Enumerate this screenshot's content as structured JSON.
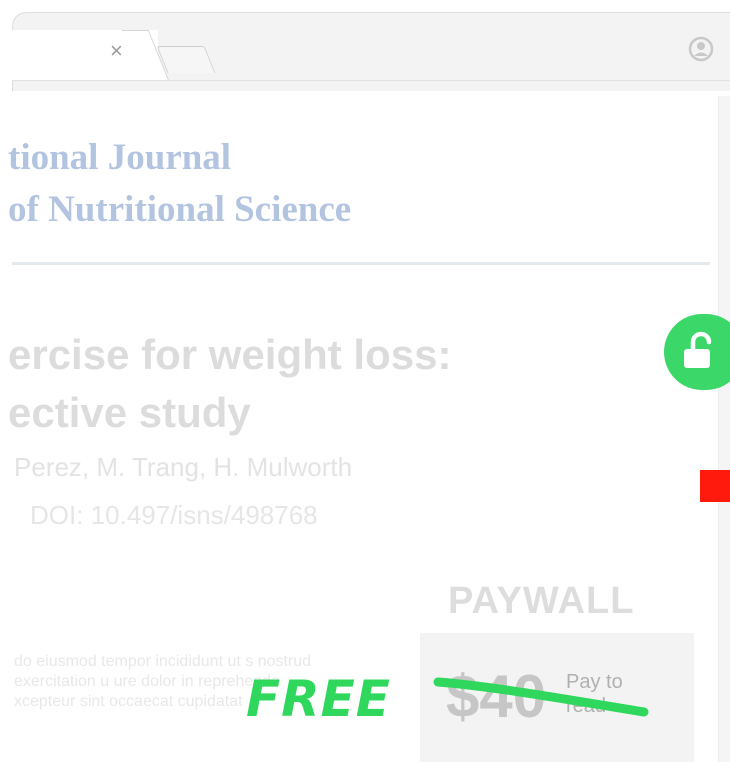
{
  "browser": {
    "close_tab_glyph": "×",
    "icons": [
      "close-icon",
      "new-tab-icon",
      "profile-icon"
    ]
  },
  "journal": {
    "title_line1": "tional Journal",
    "title_line2": "of Nutritional Science"
  },
  "article": {
    "title_line1": "ercise for weight loss:",
    "title_line2": "ective study",
    "authors": "Perez, M. Trang, H. Mulworth",
    "doi": "DOI: 10.497/isns/498768",
    "excerpt": "do eiusmod tempor incididunt ut s nostrud exercitation u ure dolor in reprehende xcepteur sint occaecat cupidatat"
  },
  "paywall": {
    "label": "PAYWALL",
    "price": "$40",
    "pay_to_read": "Pay to read",
    "free_label": "FREE"
  },
  "colors": {
    "accent_green": "#2fd85c",
    "journal_blue": "#b3c4e0",
    "marker_red": "#ff1a0d"
  },
  "lock": {
    "icon": "unlocked-padlock-icon"
  }
}
